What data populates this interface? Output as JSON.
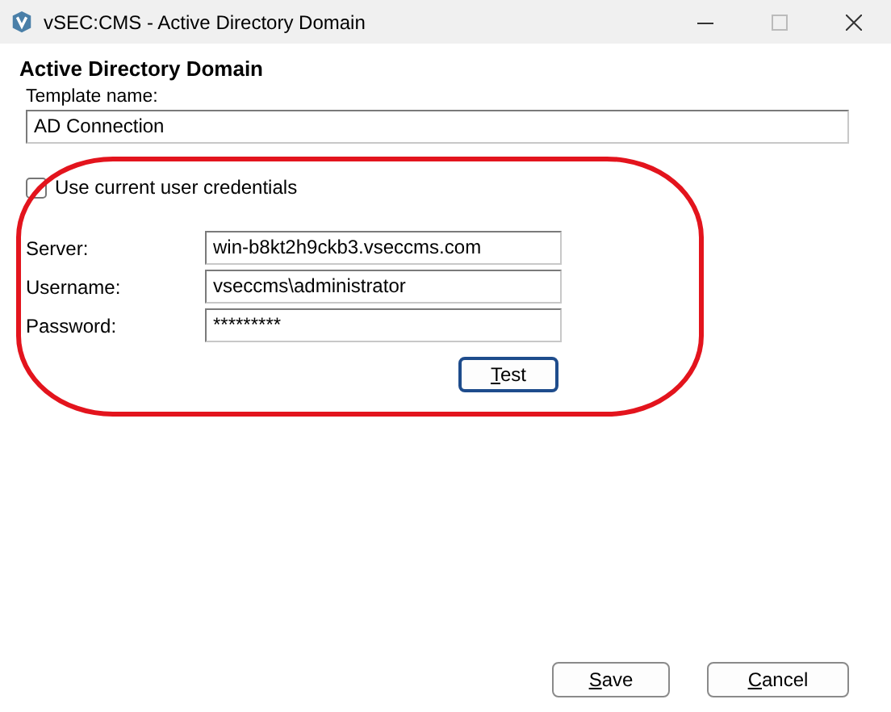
{
  "window": {
    "title": "vSEC:CMS - Active Directory Domain"
  },
  "heading": "Active Directory Domain",
  "template": {
    "label": "Template name:",
    "value": "AD Connection"
  },
  "credentials": {
    "label": "Use current user credentials",
    "checked": false
  },
  "fields": [
    {
      "label": "Server:",
      "value": "win-b8kt2h9ckb3.vseccms.com"
    },
    {
      "label": "Username:",
      "value": "vseccms\\administrator"
    },
    {
      "label": "Password:",
      "value": "*********"
    }
  ],
  "test_button": {
    "label": "Test",
    "mnemonic": true,
    "default": true
  },
  "buttons": [
    {
      "label": "Save",
      "mnemonic": true
    },
    {
      "label": "Cancel",
      "mnemonic": true
    }
  ],
  "annotation": {
    "kind": "outline"
  }
}
